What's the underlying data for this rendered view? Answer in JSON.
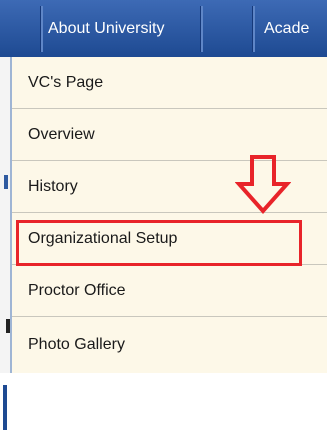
{
  "navbar": {
    "items": [
      {
        "label": "About University"
      },
      {
        "label": "Acade"
      }
    ]
  },
  "menu": {
    "items": [
      {
        "label": "VC's Page"
      },
      {
        "label": "Overview"
      },
      {
        "label": "History"
      },
      {
        "label": "Organizational Setup"
      },
      {
        "label": "Proctor Office"
      },
      {
        "label": "Photo Gallery"
      }
    ],
    "highlighted_item": "Organizational Setup"
  },
  "colors": {
    "navbar": "#1e4a92",
    "menu_background": "#fdf8e8",
    "highlight": "#e8242a"
  },
  "icons": [
    "down-arrow-icon"
  ]
}
